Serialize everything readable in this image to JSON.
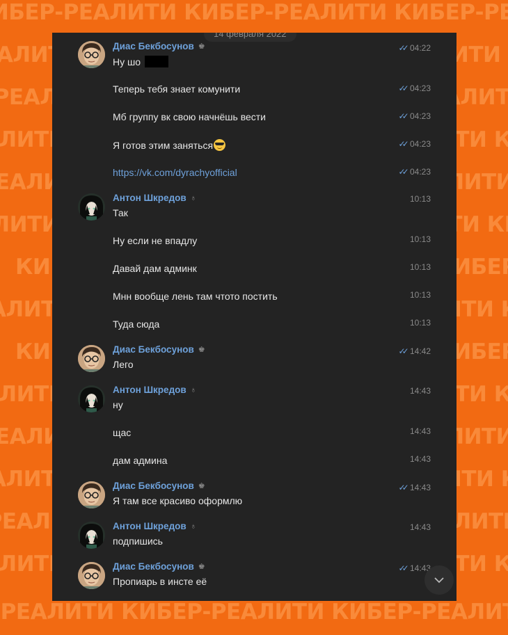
{
  "watermark": {
    "text": "КИБЕР-РЕАЛИТИ",
    "rows": [
      "КИБЕР-РЕАЛИТИ КИБЕР-РЕАЛИТИ КИБЕР-РЕАЛИТИ КИБЕР-РЕАЛИТИ",
      "РЕАЛИТИ КИБЕР-РЕАЛИТИ КИБЕР-РЕАЛИТИ КИБЕР-РЕАЛИТИ",
      "КИБЕР-РЕАЛИТИ КИБЕР-РЕАЛИТИ КИБЕР-РЕАЛИТИ КИБЕР-РЕАЛИТИ",
      "РЕАЛИТИ КИБЕР-РЕАЛИТИ КИБЕР-РЕАЛИТИ КИБЕР-РЕАЛИТИ",
      "КИБЕР-РЕАЛИТИ КИБЕР-РЕАЛИТИ КИБЕР-РЕАЛИТИ КИБЕР-РЕАЛИТИ",
      "РЕАЛИТИ КИБЕР-РЕАЛИТИ КИБЕР-РЕАЛИТИ КИБЕР-РЕАЛИТИ",
      "КИБЕР-РЕАЛИТИ КИБЕР-РЕАЛИТИ КИБЕР-РЕАЛИТИ КИБЕР-РЕАЛИТИ",
      "РЕАЛИТИ КИБЕР-РЕАЛИТИ КИБЕР-РЕАЛИТИ КИБЕР-РЕАЛИТИ",
      "КИБЕР-РЕАЛИТИ КИБЕР-РЕАЛИТИ КИБЕР-РЕАЛИТИ КИБЕР-РЕАЛИТИ",
      "РЕАЛИТИ КИБЕР-РЕАЛИТИ КИБЕР-РЕАЛИТИ КИБЕР-РЕАЛИТИ",
      "КИБЕР-РЕАЛИТИ КИБЕР-РЕАЛИТИ КИБЕР-РЕАЛИТИ КИБЕР-РЕАЛИТИ",
      "РЕАЛИТИ КИБЕР-РЕАЛИТИ КИБЕР-РЕАЛИТИ КИБЕР-РЕАЛИТИ",
      "КИБЕР-РЕАЛИТИ КИБЕР-РЕАЛИТИ КИБЕР-РЕАЛИТИ КИБЕР-РЕАЛИТИ",
      "РЕАЛИТИ КИБЕР-РЕАЛИТИ КИБЕР-РЕАЛИТИ КИБЕР-РЕАЛИТИ",
      "КИБЕР-РЕАЛИТИ КИБЕР-РЕАЛИТИ КИБЕР-РЕАЛИТИ КИБЕР-РЕАЛИТИ"
    ]
  },
  "colors": {
    "background": "#f26a12",
    "watermark": "#f98a3a",
    "chat_bg": "#232323",
    "name": "#6ea1da",
    "text": "#e6e6e6",
    "time": "#8a8a8a"
  },
  "chat": {
    "date_label": "14 февраля 2022",
    "messages": [
      {
        "author": "Диас Бекбосунов",
        "avatar": "dias",
        "badge_icon": "crown-icon",
        "text": "Ну шо",
        "redacted": true,
        "time": "04:22",
        "read": true
      },
      {
        "text": "Теперь тебя знает комунити",
        "time": "04:23",
        "read": true
      },
      {
        "text": "Мб группу вк свою начнёшь вести",
        "time": "04:23",
        "read": true
      },
      {
        "text": "Я готов этим заняться",
        "emoji": "sunglasses-emoji",
        "time": "04:23",
        "read": true
      },
      {
        "text": "https://vk.com/dyrachyofficial",
        "link": true,
        "time": "04:23",
        "read": true
      },
      {
        "author": "Антон Шкредов",
        "avatar": "anton",
        "badge_icon": "owner-icon",
        "text": "Так",
        "time": "10:13",
        "read": false
      },
      {
        "text": "Ну если не впадлу",
        "time": "10:13",
        "read": false
      },
      {
        "text": "Давай дам админк",
        "time": "10:13",
        "read": false
      },
      {
        "text": "Мнн вообще лень там чтото постить",
        "time": "10:13",
        "read": false
      },
      {
        "text": "Туда сюда",
        "time": "10:13",
        "read": false
      },
      {
        "author": "Диас Бекбосунов",
        "avatar": "dias",
        "badge_icon": "crown-icon",
        "text": "Лего",
        "time": "14:42",
        "read": true
      },
      {
        "author": "Антон Шкредов",
        "avatar": "anton",
        "badge_icon": "owner-icon",
        "text": "ну",
        "time": "14:43",
        "read": false
      },
      {
        "text": "щас",
        "time": "14:43",
        "read": false
      },
      {
        "text": "дам админа",
        "time": "14:43",
        "read": false
      },
      {
        "author": "Диас Бекбосунов",
        "avatar": "dias",
        "badge_icon": "crown-icon",
        "text": "Я там все красиво оформлю",
        "time": "14:43",
        "read": true
      },
      {
        "author": "Антон Шкредов",
        "avatar": "anton",
        "badge_icon": "owner-icon",
        "text": "подпишись",
        "time": "14:43",
        "read": false
      },
      {
        "author": "Диас Бекбосунов",
        "avatar": "dias",
        "badge_icon": "crown-icon",
        "text": "Пропиарь в инсте её",
        "time": "14:43",
        "read": true
      }
    ],
    "scroll_icon": "chevron-down-icon"
  }
}
